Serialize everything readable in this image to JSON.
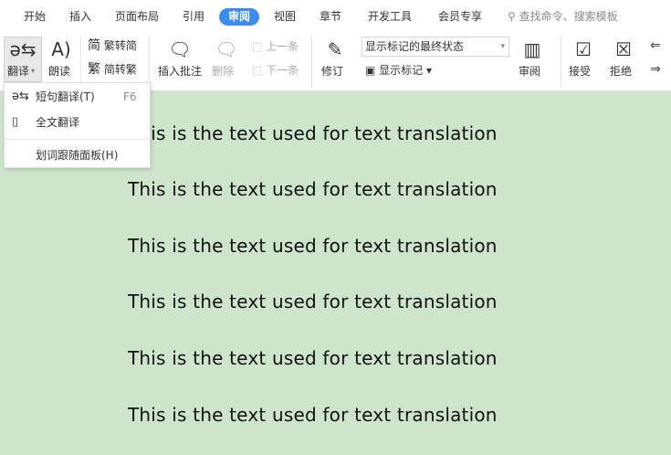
{
  "tabs": [
    "开始",
    "插入",
    "页面布局",
    "引用",
    "审阅",
    "视图",
    "章节",
    "开发工具",
    "会员专享"
  ],
  "active_tab": "审阅",
  "search_placeholder": "查找命令、搜索模板",
  "ribbon": {
    "translate": "翻译",
    "read_aloud": "朗读",
    "trad_to_simp": "繁转简",
    "simp_to_trad": "简转繁",
    "insert_comment": "插入批注",
    "delete": "删除",
    "prev": "上一条",
    "next": "下一条",
    "revise": "修订",
    "markup_mode": "显示标记的最终状态",
    "show_markup": "显示标记",
    "review": "审阅",
    "accept": "接受",
    "reject": "拒绝"
  },
  "menu": {
    "items": [
      {
        "label": "短句翻译(T)",
        "shortcut": "F6"
      },
      {
        "label": "全文翻译"
      },
      {
        "label": "划词跟随面板(H)"
      }
    ]
  },
  "document": {
    "lines": [
      "This is the text used for text translation",
      "This is the text used for text translation",
      "This is the text used for text translation",
      "This is the text used for text translation",
      "This is the text used for text translation",
      "This is the text used for text translation"
    ]
  }
}
